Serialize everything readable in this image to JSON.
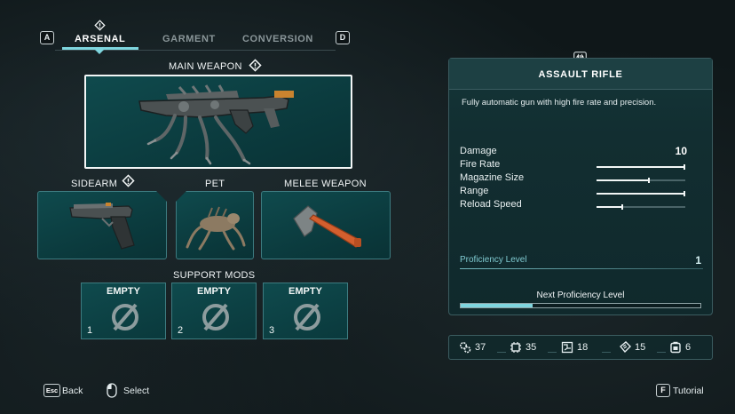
{
  "tabs": {
    "left_key": "A",
    "right_key": "D",
    "items": [
      "ARSENAL",
      "GARMENT",
      "CONVERSION"
    ],
    "active": "ARSENAL"
  },
  "loadout": {
    "main_weapon_label": "MAIN WEAPON",
    "sidearm_label": "SIDEARM",
    "pet_label": "PET",
    "melee_label": "MELEE WEAPON",
    "support_mods_label": "SUPPORT MODS",
    "mods": [
      {
        "state": "EMPTY",
        "slot": "1"
      },
      {
        "state": "EMPTY",
        "slot": "2"
      },
      {
        "state": "EMPTY",
        "slot": "3"
      }
    ]
  },
  "details": {
    "title": "ASSAULT RIFLE",
    "description": "Fully automatic gun with high fire rate and precision.",
    "stats": [
      {
        "label": "Damage",
        "value": "10"
      },
      {
        "label": "Fire Rate",
        "fill": 1.0
      },
      {
        "label": "Magazine Size",
        "fill": 0.6
      },
      {
        "label": "Range",
        "fill": 1.0
      },
      {
        "label": "Reload Speed",
        "fill": 0.3
      }
    ],
    "proficiency_label": "Proficiency Level",
    "proficiency_value": "1",
    "next_label": "Next Proficiency Level",
    "next_progress": 0.3
  },
  "resources": [
    {
      "icon": "gear-cog-icon",
      "value": "37"
    },
    {
      "icon": "chip-icon",
      "value": "35"
    },
    {
      "icon": "circuit-icon",
      "value": "18"
    },
    {
      "icon": "ticket-icon",
      "value": "15"
    },
    {
      "icon": "battery-icon",
      "value": "6"
    }
  ],
  "footer": {
    "back_key": "Esc",
    "back_label": "Back",
    "select_label": "Select",
    "tutorial_key": "F",
    "tutorial_label": "Tutorial"
  },
  "colors": {
    "accent": "#7fd6df",
    "slot_fill": "#0b3b3e",
    "slot_border": "#3d7b80",
    "panel_fill": "#122e31",
    "melee_handle": "#d35f2e"
  }
}
